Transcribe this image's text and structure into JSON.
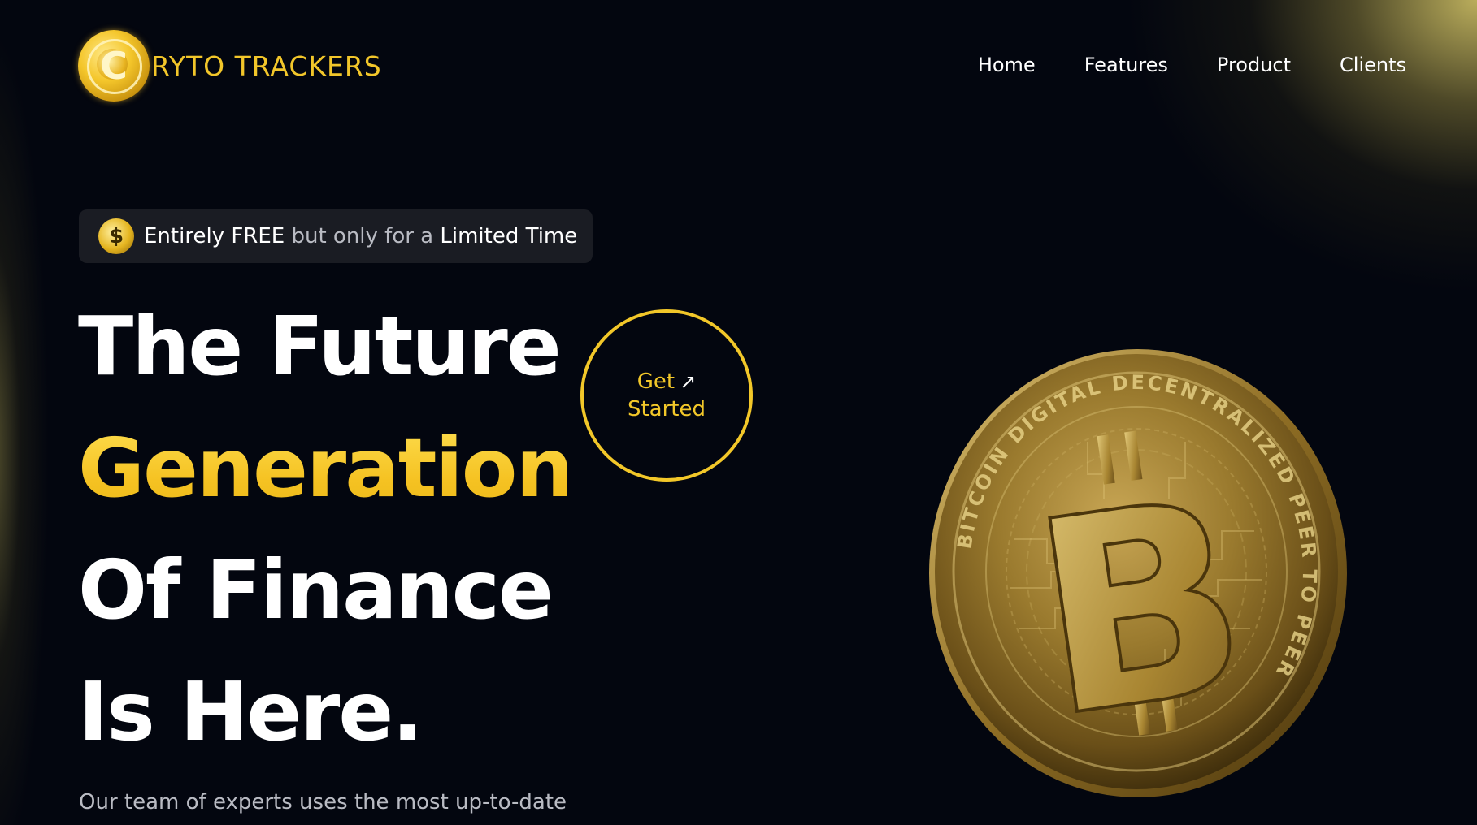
{
  "brand": {
    "logo_letter": "C",
    "name": "RYTO TRACKERS"
  },
  "nav": {
    "items": [
      "Home",
      "Features",
      "Product",
      "Clients"
    ]
  },
  "badge": {
    "icon": "dollar-coin-icon",
    "part1": "Entirely FREE",
    "part2": " but only for a ",
    "part3": "Limited Time"
  },
  "hero": {
    "line1": "The Future",
    "line2": "Generation",
    "line3": "Of Finance",
    "line4": "Is Here.",
    "subtext": "Our team of experts uses the most up-to-date"
  },
  "cta": {
    "line1": "Get",
    "arrow": "↗",
    "line2": "Started"
  },
  "coin": {
    "icon": "bitcoin-icon",
    "symbol": "B",
    "ring_text": "BITCOIN DIGITAL DECENTRALIZED PEER TO PEER"
  },
  "colors": {
    "background": "#03060f",
    "accent_gold": "#f2c729",
    "text": "#ffffff",
    "muted": "#b9bbc3",
    "badge_bg": "#1a1c23"
  }
}
